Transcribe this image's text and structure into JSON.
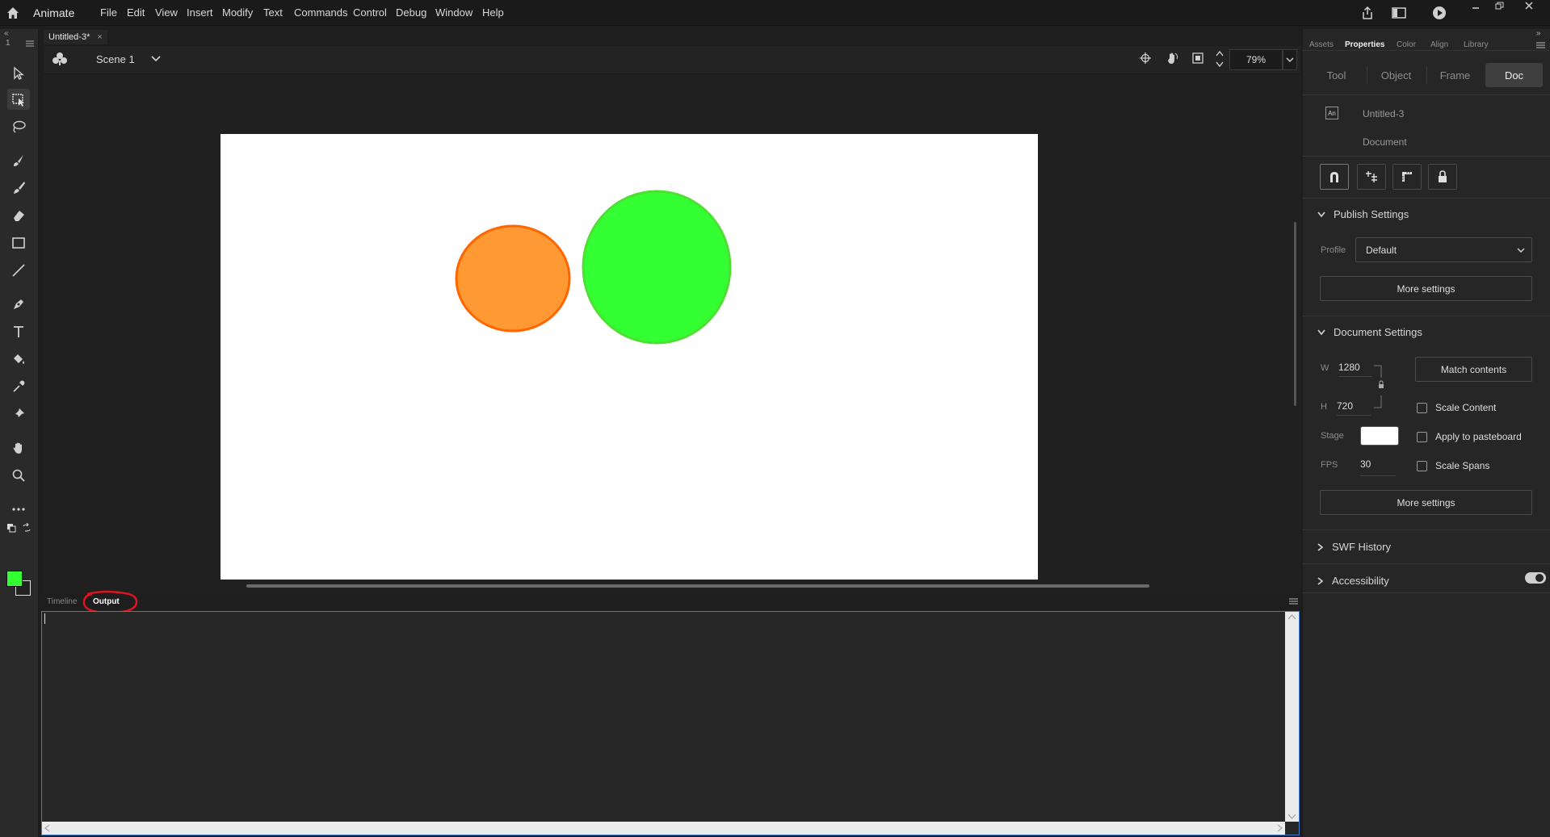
{
  "app": {
    "name": "Animate"
  },
  "menu": [
    "File",
    "Edit",
    "View",
    "Insert",
    "Modify",
    "Text",
    "Commands",
    "Control",
    "Debug",
    "Window",
    "Help"
  ],
  "document_tab": {
    "title": "Untitled-3*",
    "close": "×"
  },
  "toolbar": {
    "collapse_glyph": "«",
    "index": "1",
    "fill_color": "#33ff33"
  },
  "edit_bar": {
    "scene": "Scene 1",
    "zoom": "79%"
  },
  "stage": {
    "background": "#ffffff",
    "shapes": [
      {
        "name": "orange-circle",
        "fill": "#ff9933",
        "stroke": "#ff6600"
      },
      {
        "name": "green-circle",
        "fill": "#33ff33",
        "stroke": "#4ddf33"
      }
    ]
  },
  "bottom_panel": {
    "tabs": [
      "Timeline",
      "Output"
    ],
    "active": "Output",
    "annotation_color": "#e0141e"
  },
  "right_panel": {
    "top_tabs": [
      "Assets",
      "Properties",
      "Color",
      "Align",
      "Library"
    ],
    "active_top_tab": "Properties",
    "segments": [
      "Tool",
      "Object",
      "Frame",
      "Doc"
    ],
    "active_segment": "Doc",
    "doc_icon_text": "An",
    "doc_name": "Untitled-3",
    "doc_type": "Document",
    "publish": {
      "title": "Publish Settings",
      "profile_label": "Profile",
      "profile_value": "Default",
      "more": "More settings"
    },
    "document_settings": {
      "title": "Document Settings",
      "w_label": "W",
      "w_value": "1280",
      "h_label": "H",
      "h_value": "720",
      "match": "Match contents",
      "stage_label": "Stage",
      "stage_color": "#ffffff",
      "fps_label": "FPS",
      "fps_value": "30",
      "scale_content": "Scale Content",
      "apply_pasteboard": "Apply to pasteboard",
      "scale_spans": "Scale Spans",
      "more": "More settings"
    },
    "swf_history": "SWF History",
    "accessibility": "Accessibility"
  }
}
